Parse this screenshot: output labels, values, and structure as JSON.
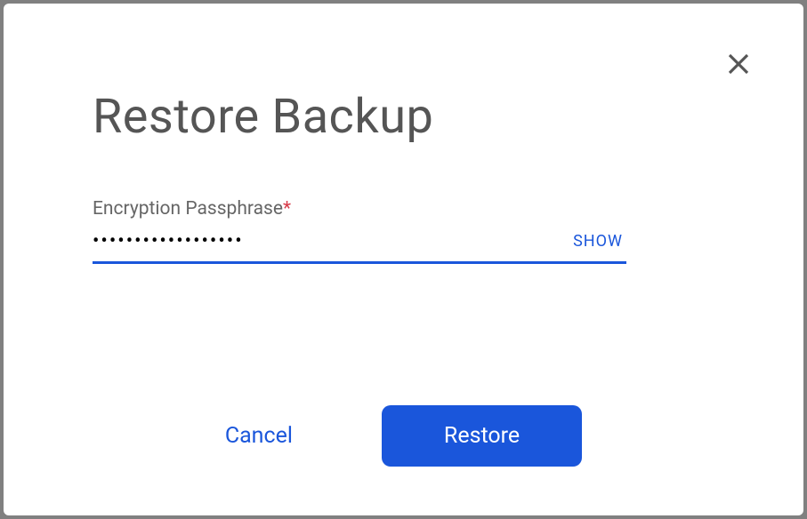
{
  "dialog": {
    "title": "Restore Backup"
  },
  "field": {
    "label": "Encryption Passphrase",
    "required_marker": "*",
    "value": "••••••••••••••••••",
    "show_label": "SHOW"
  },
  "buttons": {
    "cancel": "Cancel",
    "restore": "Restore"
  }
}
